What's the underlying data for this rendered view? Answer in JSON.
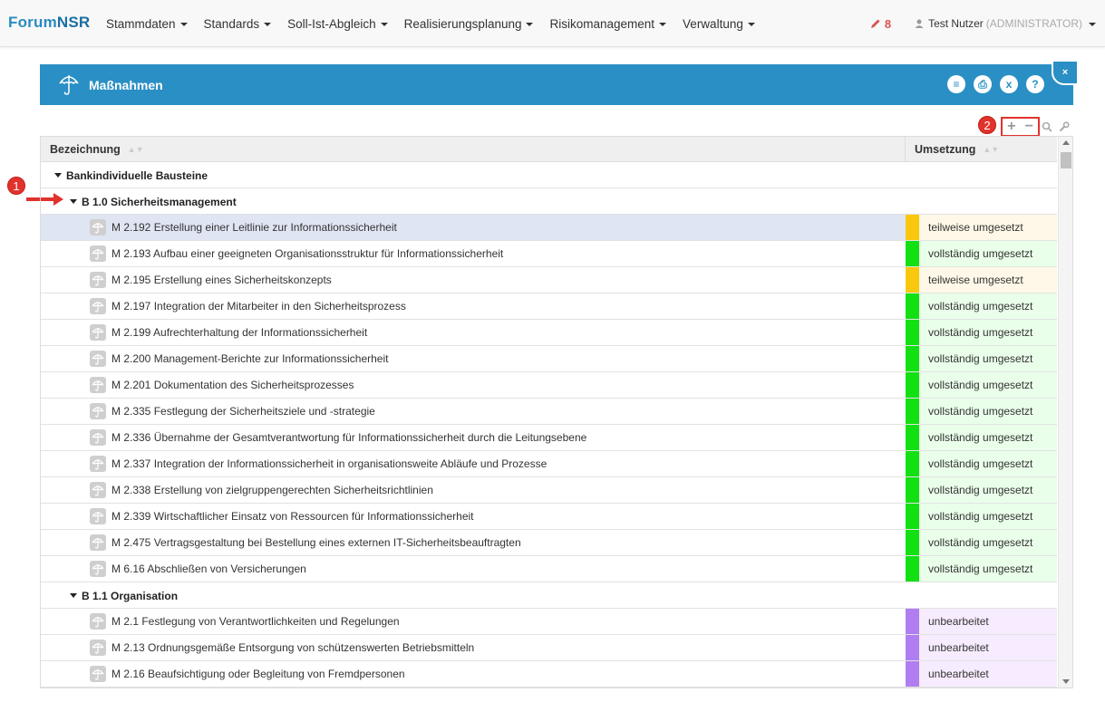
{
  "brand": {
    "part1": "Forum",
    "part2": "NSR"
  },
  "nav": {
    "items": [
      {
        "label": "Stammdaten"
      },
      {
        "label": "Standards"
      },
      {
        "label": "Soll-Ist-Abgleich"
      },
      {
        "label": "Realisierungsplanung"
      },
      {
        "label": "Risikomanagement"
      },
      {
        "label": "Verwaltung"
      }
    ],
    "edit_count": "8",
    "user_name": "Test Nutzer",
    "user_role": "(ADMINISTRATOR)"
  },
  "panel": {
    "title": "Maßnahmen",
    "buttons": [
      {
        "icon": "list-icon",
        "glyph": "≡"
      },
      {
        "icon": "pdf-icon",
        "glyph": "⎙"
      },
      {
        "icon": "excel-icon",
        "glyph": "x"
      },
      {
        "icon": "help-icon",
        "glyph": "?"
      }
    ],
    "close_glyph": "×"
  },
  "annotations": {
    "one": "1",
    "two": "2"
  },
  "tools": {
    "expand": "+",
    "collapse": "−"
  },
  "table": {
    "col_name": "Bezeichnung",
    "col_status": "Umsetzung",
    "sort_glyph": "▲▼",
    "rows": [
      {
        "type": "group",
        "level": 0,
        "label": "Bankindividuelle Bausteine"
      },
      {
        "type": "group",
        "level": 1,
        "label": "B 1.0 Sicherheitsmanagement"
      },
      {
        "type": "item",
        "label": "M 2.192 Erstellung einer Leitlinie zur Informationssicherheit",
        "status": "teilweise umgesetzt",
        "color": "#f9c80e",
        "bg": "#fff8e8",
        "selected": true
      },
      {
        "type": "item",
        "label": "M 2.193 Aufbau einer geeigneten Organisationsstruktur für Informationssicherheit",
        "status": "vollständig umgesetzt",
        "color": "#13e013",
        "bg": "#eaffea"
      },
      {
        "type": "item",
        "label": "M 2.195 Erstellung eines Sicherheitskonzepts",
        "status": "teilweise umgesetzt",
        "color": "#f9c80e",
        "bg": "#fff8e8"
      },
      {
        "type": "item",
        "label": "M 2.197 Integration der Mitarbeiter in den Sicherheitsprozess",
        "status": "vollständig umgesetzt",
        "color": "#13e013",
        "bg": "#eaffea"
      },
      {
        "type": "item",
        "label": "M 2.199 Aufrechterhaltung der Informationssicherheit",
        "status": "vollständig umgesetzt",
        "color": "#13e013",
        "bg": "#eaffea"
      },
      {
        "type": "item",
        "label": "M 2.200 Management-Berichte zur Informationssicherheit",
        "status": "vollständig umgesetzt",
        "color": "#13e013",
        "bg": "#eaffea"
      },
      {
        "type": "item",
        "label": "M 2.201 Dokumentation des Sicherheitsprozesses",
        "status": "vollständig umgesetzt",
        "color": "#13e013",
        "bg": "#eaffea"
      },
      {
        "type": "item",
        "label": "M 2.335 Festlegung der Sicherheitsziele und -strategie",
        "status": "vollständig umgesetzt",
        "color": "#13e013",
        "bg": "#eaffea"
      },
      {
        "type": "item",
        "label": "M 2.336 Übernahme der Gesamtverantwortung für Informationssicherheit durch die Leitungsebene",
        "status": "vollständig umgesetzt",
        "color": "#13e013",
        "bg": "#eaffea"
      },
      {
        "type": "item",
        "label": "M 2.337 Integration der Informationssicherheit in organisationsweite Abläufe und Prozesse",
        "status": "vollständig umgesetzt",
        "color": "#13e013",
        "bg": "#eaffea"
      },
      {
        "type": "item",
        "label": "M 2.338 Erstellung von zielgruppengerechten Sicherheitsrichtlinien",
        "status": "vollständig umgesetzt",
        "color": "#13e013",
        "bg": "#eaffea"
      },
      {
        "type": "item",
        "label": "M 2.339 Wirtschaftlicher Einsatz von Ressourcen für Informationssicherheit",
        "status": "vollständig umgesetzt",
        "color": "#13e013",
        "bg": "#eaffea"
      },
      {
        "type": "item",
        "label": "M 2.475 Vertragsgestaltung bei Bestellung eines externen IT-Sicherheitsbeauftragten",
        "status": "vollständig umgesetzt",
        "color": "#13e013",
        "bg": "#eaffea"
      },
      {
        "type": "item",
        "label": "M 6.16 Abschließen von Versicherungen",
        "status": "vollständig umgesetzt",
        "color": "#13e013",
        "bg": "#eaffea"
      },
      {
        "type": "group",
        "level": 1,
        "label": "B 1.1 Organisation"
      },
      {
        "type": "item",
        "label": "M 2.1 Festlegung von Verantwortlichkeiten und Regelungen",
        "status": "unbearbeitet",
        "color": "#b07ef0",
        "bg": "#f7ecff"
      },
      {
        "type": "item",
        "label": "M 2.13 Ordnungsgemäße Entsorgung von schützenswerten Betriebsmitteln",
        "status": "unbearbeitet",
        "color": "#b07ef0",
        "bg": "#f7ecff"
      },
      {
        "type": "item",
        "label": "M 2.16 Beaufsichtigung oder Begleitung von Fremdpersonen",
        "status": "unbearbeitet",
        "color": "#b07ef0",
        "bg": "#f7ecff"
      }
    ]
  }
}
